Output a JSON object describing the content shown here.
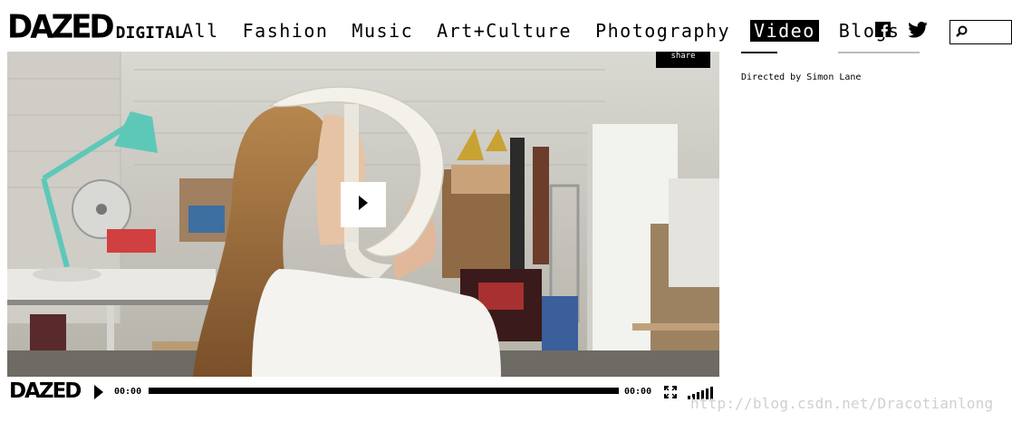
{
  "header": {
    "logo_main": "DAZED",
    "logo_sub": "DIGITAL",
    "nav": [
      {
        "label": "All",
        "active": false
      },
      {
        "label": "Fashion",
        "active": false
      },
      {
        "label": "Music",
        "active": false
      },
      {
        "label": "Art+Culture",
        "active": false
      },
      {
        "label": "Photography",
        "active": false
      },
      {
        "label": "Video",
        "active": true
      },
      {
        "label": "Blogs",
        "active": false
      }
    ],
    "social": {
      "facebook_icon": "facebook-icon",
      "twitter_icon": "twitter-icon"
    },
    "search": {
      "icon": "search-icon",
      "value": "",
      "placeholder": ""
    }
  },
  "video": {
    "share_label": "share",
    "play_icon": "play-icon"
  },
  "controls": {
    "logo": "DAZED",
    "current_time": "00:00",
    "duration": "00:00",
    "progress": 0,
    "fullscreen_icon": "fullscreen-icon",
    "volume_icon": "volume-icon"
  },
  "sidebar": {
    "credit": "Directed by Simon Lane"
  },
  "watermark": "http://blog.csdn.net/Dracotianlong",
  "colors": {
    "brand": "#000000",
    "background": "#ffffff",
    "lamp": "#5ec8b8"
  }
}
